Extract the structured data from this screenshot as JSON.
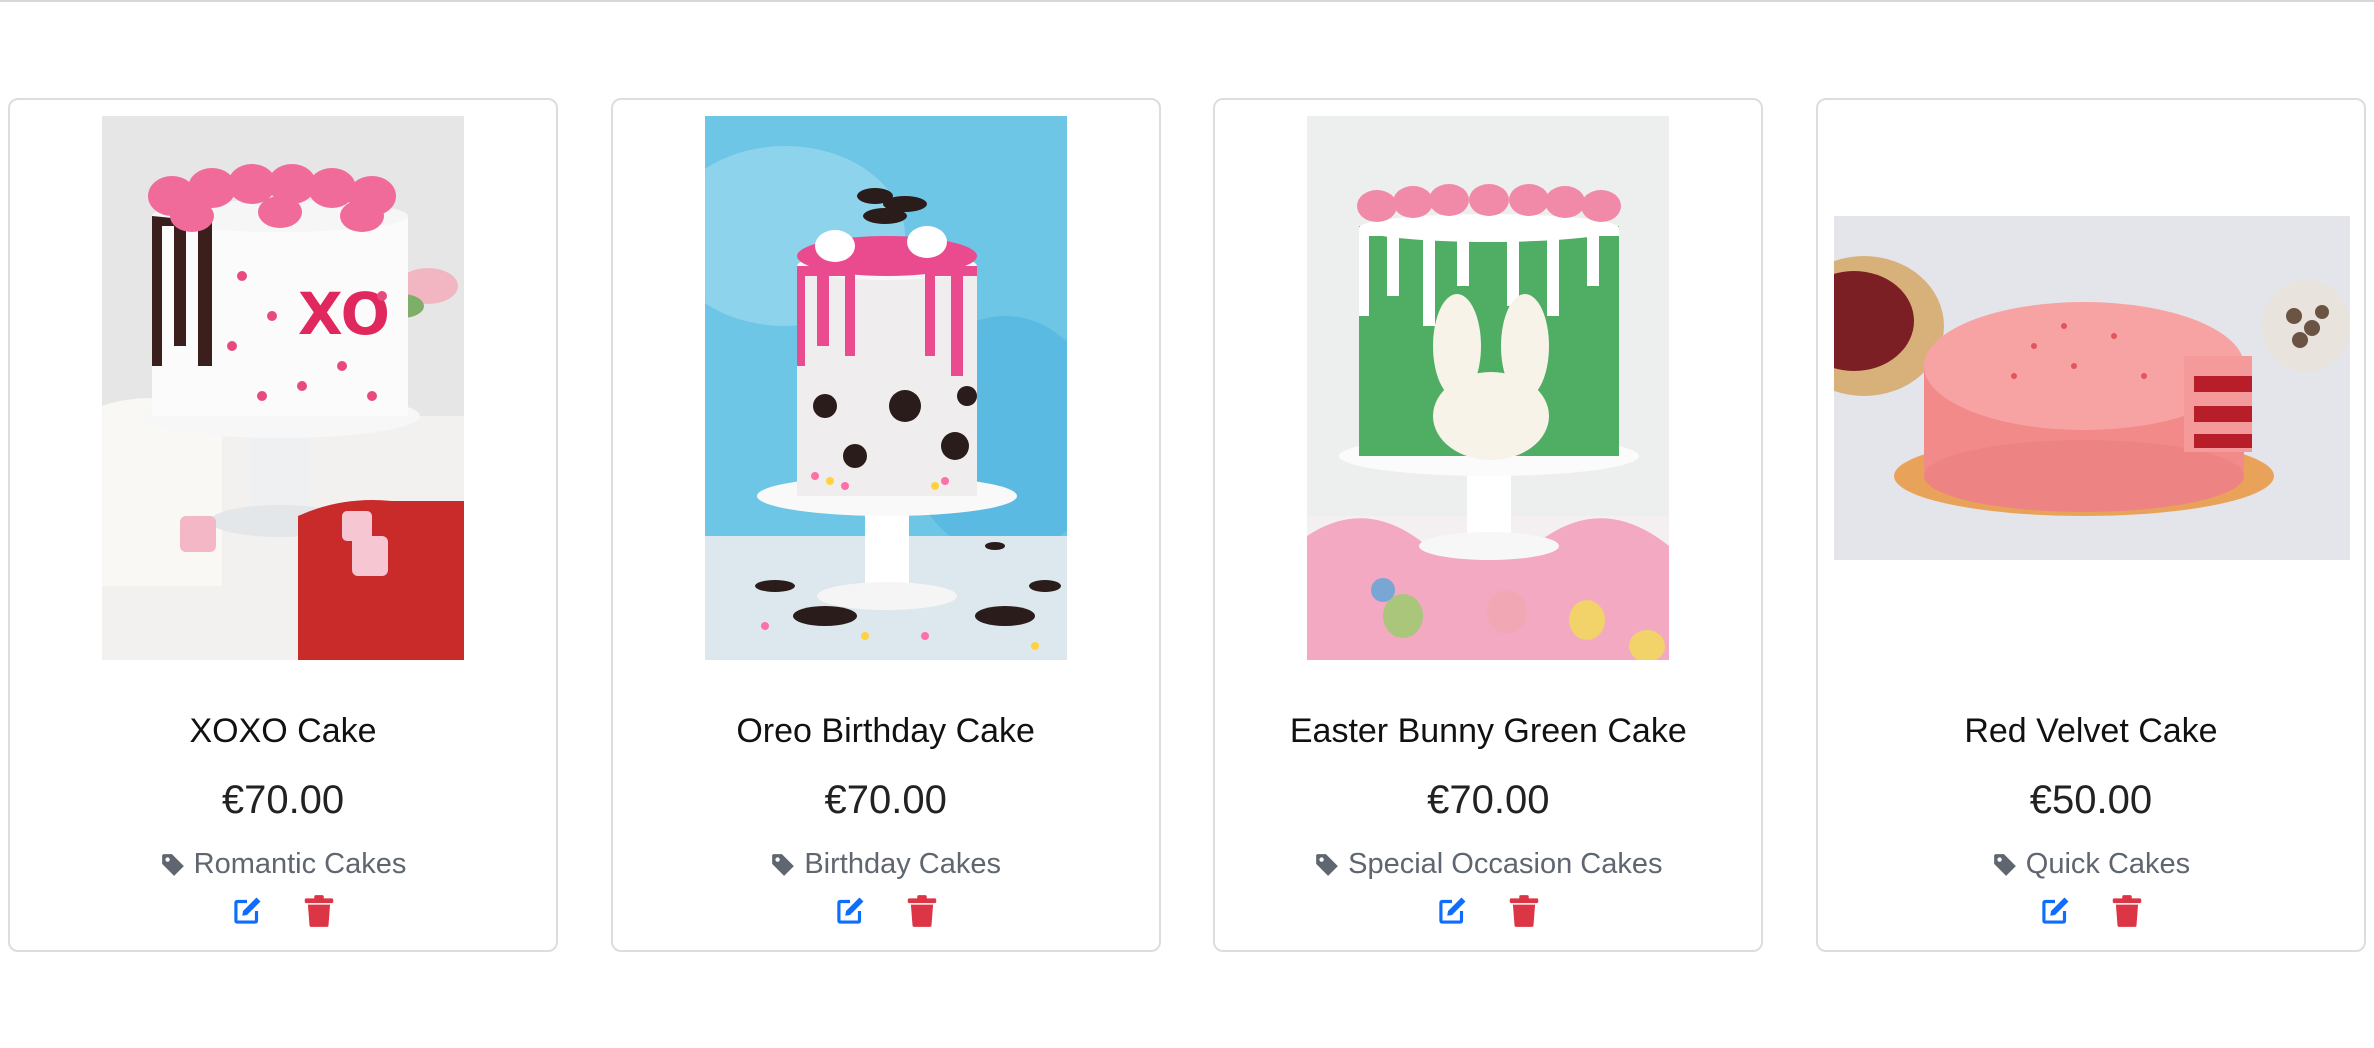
{
  "colors": {
    "edit_icon": "#0d6efd",
    "delete_icon": "#dc3545",
    "category_text": "#5f6670",
    "card_border": "#dddddd"
  },
  "icons": {
    "category": "tag-icon",
    "edit": "edit-icon",
    "delete": "trash-icon"
  },
  "products": [
    {
      "title": "XOXO Cake",
      "price": "€70.00",
      "category": "Romantic Cakes"
    },
    {
      "title": "Oreo Birthday Cake",
      "price": "€70.00",
      "category": "Birthday Cakes"
    },
    {
      "title": "Easter Bunny Green Cake",
      "price": "€70.00",
      "category": "Special Occasion Cakes"
    },
    {
      "title": "Red Velvet Cake",
      "price": "€50.00",
      "category": "Quick Cakes"
    }
  ]
}
